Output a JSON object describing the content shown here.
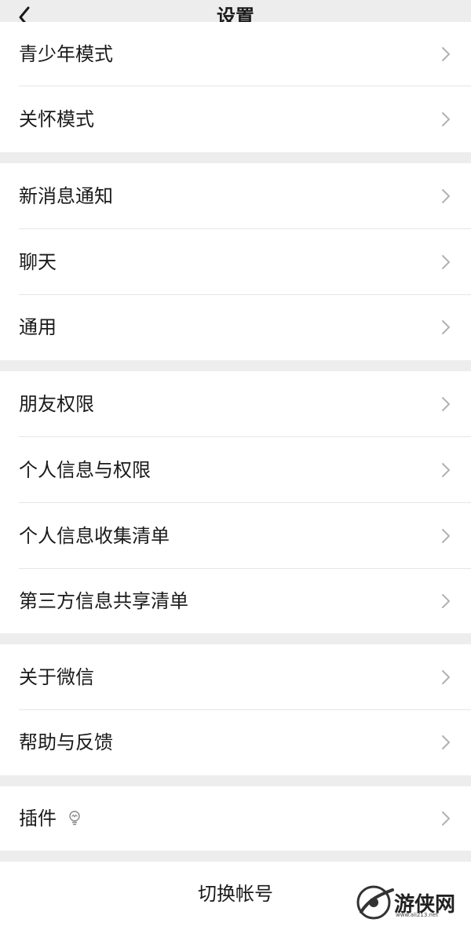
{
  "header": {
    "title": "设置",
    "back_icon": "chevron-left-icon"
  },
  "groups": [
    {
      "items": [
        {
          "label": "青少年模式"
        },
        {
          "label": "关怀模式"
        }
      ]
    },
    {
      "items": [
        {
          "label": "新消息通知"
        },
        {
          "label": "聊天"
        },
        {
          "label": "通用"
        }
      ]
    },
    {
      "items": [
        {
          "label": "朋友权限"
        },
        {
          "label": "个人信息与权限"
        },
        {
          "label": "个人信息收集清单"
        },
        {
          "label": "第三方信息共享清单"
        }
      ]
    },
    {
      "items": [
        {
          "label": "关于微信"
        },
        {
          "label": "帮助与反馈"
        }
      ]
    },
    {
      "items": [
        {
          "label": "插件",
          "icon": "bulb-icon"
        }
      ]
    }
  ],
  "switch_account": "切换帐号",
  "watermark": {
    "text": "游侠网",
    "sub": "www.ali213.net"
  },
  "colors": {
    "background": "#ededed",
    "card": "#ffffff",
    "text": "#1a1a1a",
    "chevron": "#b2b2b2",
    "divider": "#e6e6e6"
  }
}
